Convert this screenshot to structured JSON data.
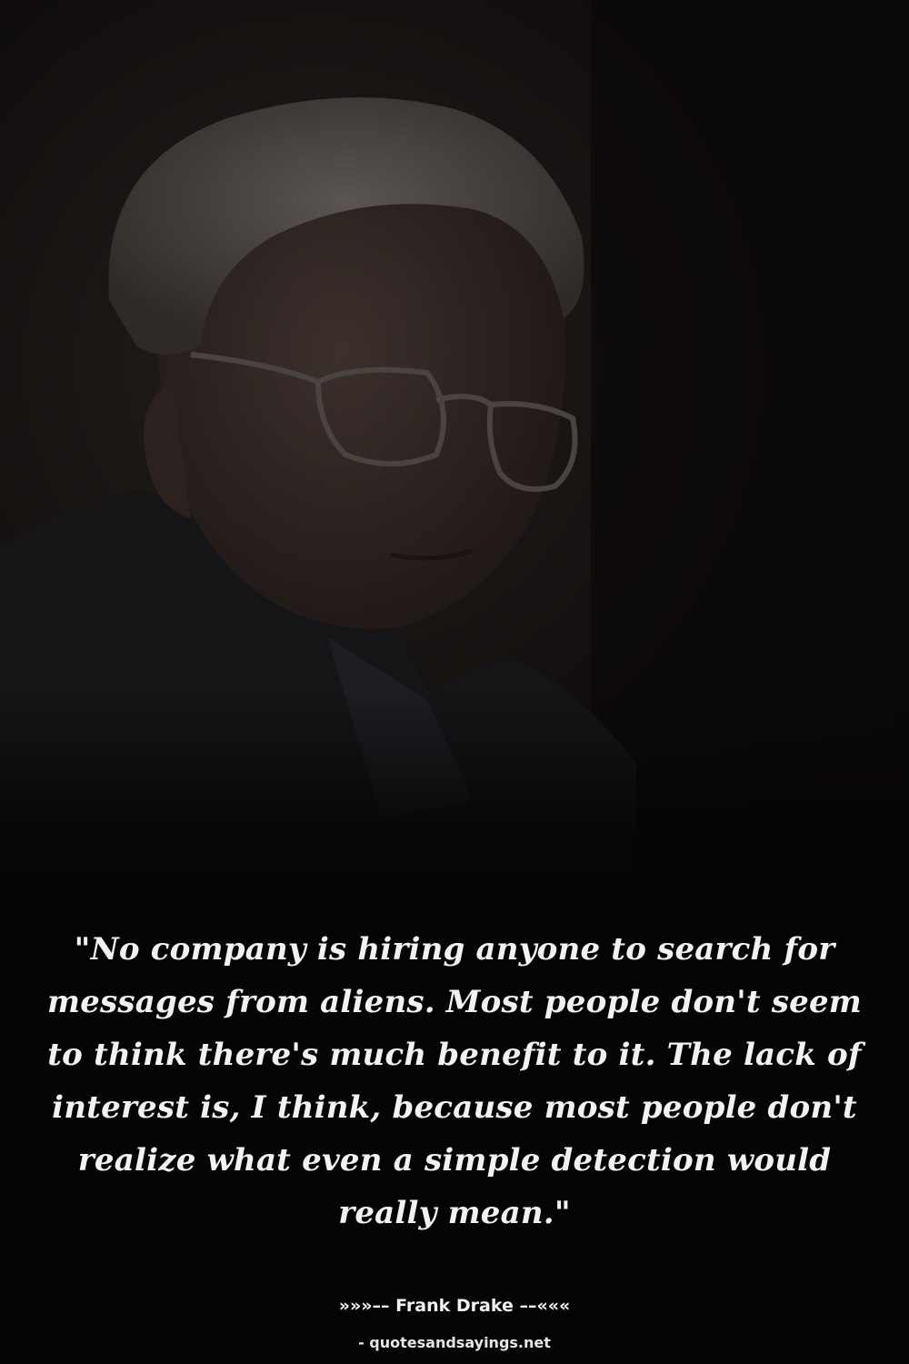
{
  "quote": {
    "text": "\"No company is hiring anyone to search for messages from aliens. Most people don't seem to think there's much benefit to it. The lack of interest is, I think, because most people don't realize what even a simple detection would really mean.\""
  },
  "author": {
    "line": "»»»–– Frank Drake ––«««"
  },
  "footer": {
    "site": "- quotesandsayings.net"
  },
  "colors": {
    "background": "#050404",
    "text": "#f2f2f2"
  }
}
